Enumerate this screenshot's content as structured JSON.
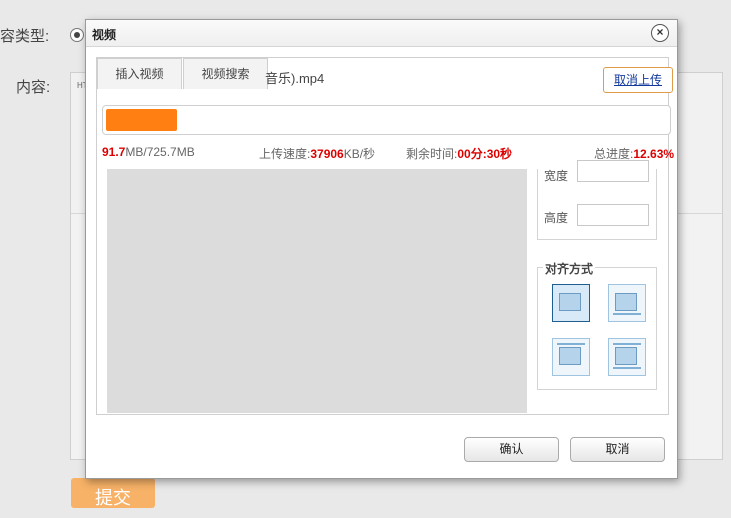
{
  "background": {
    "content_type_label": "容类型:",
    "content_label": "内容:",
    "editor_tool_html": "HT",
    "submit_label": "提交"
  },
  "dialog": {
    "title": "视频",
    "close_icon": "close-icon",
    "tabs": [
      {
        "label": "插入视频"
      },
      {
        "label": "视频搜索"
      }
    ],
    "filename": "音乐).mp4",
    "cancel_upload_label": "取消上传",
    "progress_percent": 12.63,
    "stats": {
      "uploaded": "91.7",
      "uploaded_unit": "MB/725.7MB",
      "speed_label": "上传速度:",
      "speed_value": "37906",
      "speed_unit": "KB/秒",
      "remaining_label": "剩余时间:",
      "remaining_value": "00分:30秒",
      "total_label": "总进度:",
      "total_value": "12.63%"
    },
    "width_label": "宽度",
    "height_label": "高度",
    "align_label": "对齐方式",
    "align_options": [
      "align-none-icon",
      "align-left-icon",
      "align-right-icon",
      "align-center-icon"
    ],
    "ok_label": "确认",
    "cancel_label": "取消"
  },
  "colors": {
    "progress": "#ff7f12",
    "highlight": "#d00000",
    "cancel_link": "#123a9c"
  }
}
